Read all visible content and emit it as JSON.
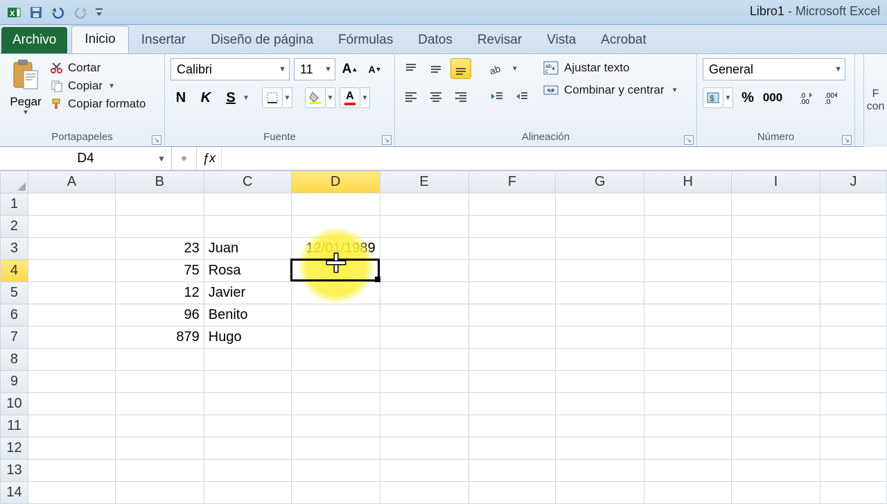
{
  "app": {
    "document": "Libro1",
    "product": "Microsoft Excel"
  },
  "tabs": {
    "file": "Archivo",
    "items": [
      "Inicio",
      "Insertar",
      "Diseño de página",
      "Fórmulas",
      "Datos",
      "Revisar",
      "Vista",
      "Acrobat"
    ],
    "active": 0
  },
  "ribbon": {
    "clipboard": {
      "label": "Portapapeles",
      "paste": "Pegar",
      "cut": "Cortar",
      "copy": "Copiar",
      "format_painter": "Copiar formato"
    },
    "font": {
      "label": "Fuente",
      "name": "Calibri",
      "size": "11"
    },
    "alignment": {
      "label": "Alineación",
      "wrap": "Ajustar texto",
      "merge": "Combinar y centrar"
    },
    "number": {
      "label": "Número",
      "format": "General",
      "thousands": "000"
    },
    "edge": {
      "line1": "F",
      "line2": "con"
    }
  },
  "namebox": "D4",
  "formula": "",
  "columns": [
    "A",
    "B",
    "C",
    "D",
    "E",
    "F",
    "G",
    "H",
    "I",
    "J"
  ],
  "selected_col_index": 3,
  "selected_row_index": 3,
  "rows": [
    "1",
    "2",
    "3",
    "4",
    "5",
    "6",
    "7",
    "8",
    "9",
    "10",
    "11",
    "12",
    "13",
    "14"
  ],
  "cells": {
    "B3": "23",
    "C3": "Juan",
    "D3": "12/01/1989",
    "B4": "75",
    "C4": "Rosa",
    "B5": "12",
    "C5": "Javier",
    "B6": "96",
    "C6": "Benito",
    "B7": "879",
    "C7": "Hugo"
  },
  "chart_data": {
    "type": "table",
    "columns": [
      "B",
      "C",
      "D"
    ],
    "rows": [
      {
        "B": 23,
        "C": "Juan",
        "D": "12/01/1989"
      },
      {
        "B": 75,
        "C": "Rosa",
        "D": ""
      },
      {
        "B": 12,
        "C": "Javier",
        "D": ""
      },
      {
        "B": 96,
        "C": "Benito",
        "D": ""
      },
      {
        "B": 879,
        "C": "Hugo",
        "D": ""
      }
    ]
  }
}
